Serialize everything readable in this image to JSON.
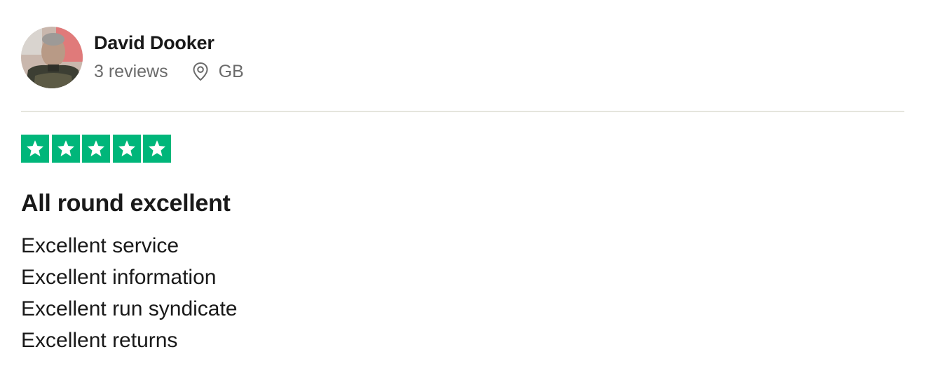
{
  "consumer": {
    "name": "David Dooker",
    "review_count": "3 reviews",
    "location": "GB",
    "avatar_icon": "avatar-photo",
    "location_icon": "location-pin-icon"
  },
  "review": {
    "rating": 5,
    "rating_max": 5,
    "star_color": "#00b67a",
    "title": "All round excellent",
    "lines": [
      "Excellent service",
      "Excellent information",
      "Excellent run syndicate",
      "Excellent returns"
    ]
  }
}
